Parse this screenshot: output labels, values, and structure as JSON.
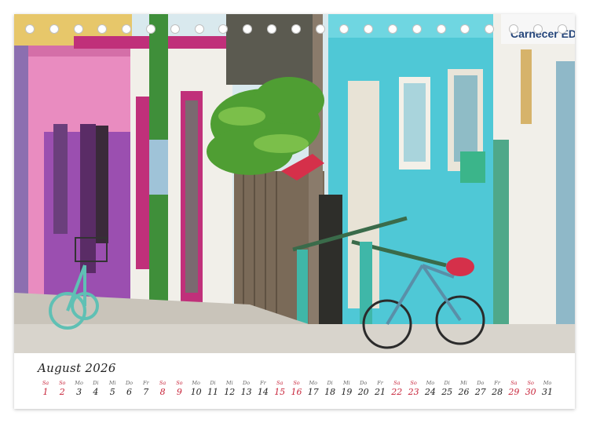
{
  "calendar": {
    "month_title": "August 2026",
    "days": [
      {
        "wd": "Sa",
        "d": "1",
        "red": true
      },
      {
        "wd": "So",
        "d": "2",
        "red": true
      },
      {
        "wd": "Mo",
        "d": "3",
        "red": false
      },
      {
        "wd": "Di",
        "d": "4",
        "red": false
      },
      {
        "wd": "Mi",
        "d": "5",
        "red": false
      },
      {
        "wd": "Do",
        "d": "6",
        "red": false
      },
      {
        "wd": "Fr",
        "d": "7",
        "red": false
      },
      {
        "wd": "Sa",
        "d": "8",
        "red": true
      },
      {
        "wd": "So",
        "d": "9",
        "red": true
      },
      {
        "wd": "Mo",
        "d": "10",
        "red": false
      },
      {
        "wd": "Di",
        "d": "11",
        "red": false
      },
      {
        "wd": "Mi",
        "d": "12",
        "red": false
      },
      {
        "wd": "Do",
        "d": "13",
        "red": false
      },
      {
        "wd": "Fr",
        "d": "14",
        "red": false
      },
      {
        "wd": "Sa",
        "d": "15",
        "red": true
      },
      {
        "wd": "So",
        "d": "16",
        "red": true
      },
      {
        "wd": "Mo",
        "d": "17",
        "red": false
      },
      {
        "wd": "Di",
        "d": "18",
        "red": false
      },
      {
        "wd": "Mi",
        "d": "19",
        "red": false
      },
      {
        "wd": "Do",
        "d": "20",
        "red": false
      },
      {
        "wd": "Fr",
        "d": "21",
        "red": false
      },
      {
        "wd": "Sa",
        "d": "22",
        "red": true
      },
      {
        "wd": "So",
        "d": "23",
        "red": true
      },
      {
        "wd": "Mo",
        "d": "24",
        "red": false
      },
      {
        "wd": "Di",
        "d": "25",
        "red": false
      },
      {
        "wd": "Mi",
        "d": "26",
        "red": false
      },
      {
        "wd": "Do",
        "d": "27",
        "red": false
      },
      {
        "wd": "Fr",
        "d": "28",
        "red": false
      },
      {
        "wd": "Sa",
        "d": "29",
        "red": true
      },
      {
        "wd": "So",
        "d": "30",
        "red": true
      },
      {
        "wd": "Mo",
        "d": "31",
        "red": false
      }
    ]
  },
  "photo": {
    "sign_text": "Carnecer EDGE",
    "colors": {
      "sky": "#d9e9ee",
      "pink_wall": "#e98cc0",
      "purple_wall": "#9b4fb0",
      "magenta_trim": "#c0307a",
      "turquoise_wall": "#4fc8d6",
      "white_wall": "#f1efe9",
      "pole_green": "#3f8f3a",
      "leaf_green": "#4f9e33",
      "street": "#d8d4cc",
      "sidewalk": "#c9c4ba",
      "bike_teal": "#5fc0b4",
      "bike_red": "#d5304a"
    }
  },
  "binding_holes": 23
}
